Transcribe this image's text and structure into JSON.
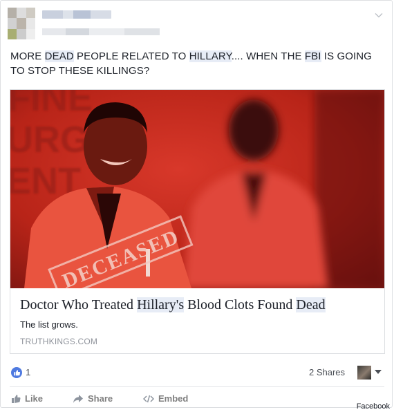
{
  "post": {
    "text_parts": [
      {
        "text": "MORE ",
        "hl": false
      },
      {
        "text": "DEAD",
        "hl": true
      },
      {
        "text": " PEOPLE RELATED TO ",
        "hl": false
      },
      {
        "text": "HILLARY",
        "hl": true
      },
      {
        "text": ".... WHEN THE ",
        "hl": false
      },
      {
        "text": "FBI",
        "hl": true
      },
      {
        "text": " IS GOING TO STOP THESE KILLINGS?",
        "hl": false
      }
    ]
  },
  "link_preview": {
    "image_stamp": "DECEASED",
    "title_parts": [
      {
        "text": "Doctor Who Treated ",
        "hl": false
      },
      {
        "text": "Hillary's",
        "hl": true
      },
      {
        "text": " Blood Clots Found ",
        "hl": false
      },
      {
        "text": "Dead",
        "hl": true
      }
    ],
    "description": "The list grows.",
    "domain": "TRUTHKINGS.COM"
  },
  "stats": {
    "likes": "1",
    "shares": "2 Shares"
  },
  "actions": {
    "like": "Like",
    "share": "Share",
    "embed": "Embed"
  },
  "credit": "Facebook",
  "icons": {
    "like": "thumbs-up-icon",
    "share": "share-arrow-icon",
    "embed": "code-icon",
    "menu": "chevron-down-icon"
  },
  "colors": {
    "facebook_blue": "#4f7ae0",
    "image_tint": "#c8281c",
    "highlight": "#e7ecf6"
  }
}
